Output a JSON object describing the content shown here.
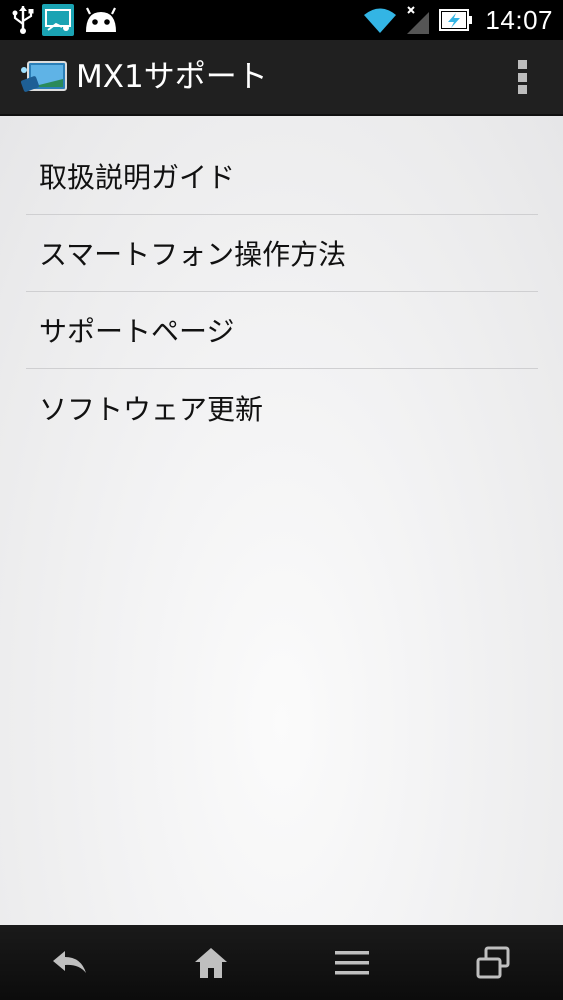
{
  "status_bar": {
    "time": "14:07",
    "left_icons": [
      "usb-icon",
      "screen-mirror-notification-icon",
      "android-notification-icon"
    ],
    "right_icons": [
      "wifi-icon",
      "signal-no-sim-icon",
      "battery-charging-icon"
    ]
  },
  "action_bar": {
    "title": "MX1サポート",
    "app_icon": "mx1-app-icon",
    "overflow_icon": "overflow-menu-icon"
  },
  "menu": {
    "items": [
      {
        "label": "取扱説明ガイド"
      },
      {
        "label": "スマートフォン操作方法"
      },
      {
        "label": "サポートページ"
      },
      {
        "label": "ソフトウェア更新"
      }
    ]
  },
  "nav_bar": {
    "buttons": [
      "back-icon",
      "home-icon",
      "menu-icon",
      "recent-apps-icon"
    ]
  },
  "colors": {
    "status_bar_bg": "#000000",
    "action_bar_bg": "#202020",
    "content_bg": "#eaeaea",
    "divider": "#cfcfd1",
    "wifi_accent": "#33b5e5",
    "nav_icon": "#bfbfbf"
  }
}
